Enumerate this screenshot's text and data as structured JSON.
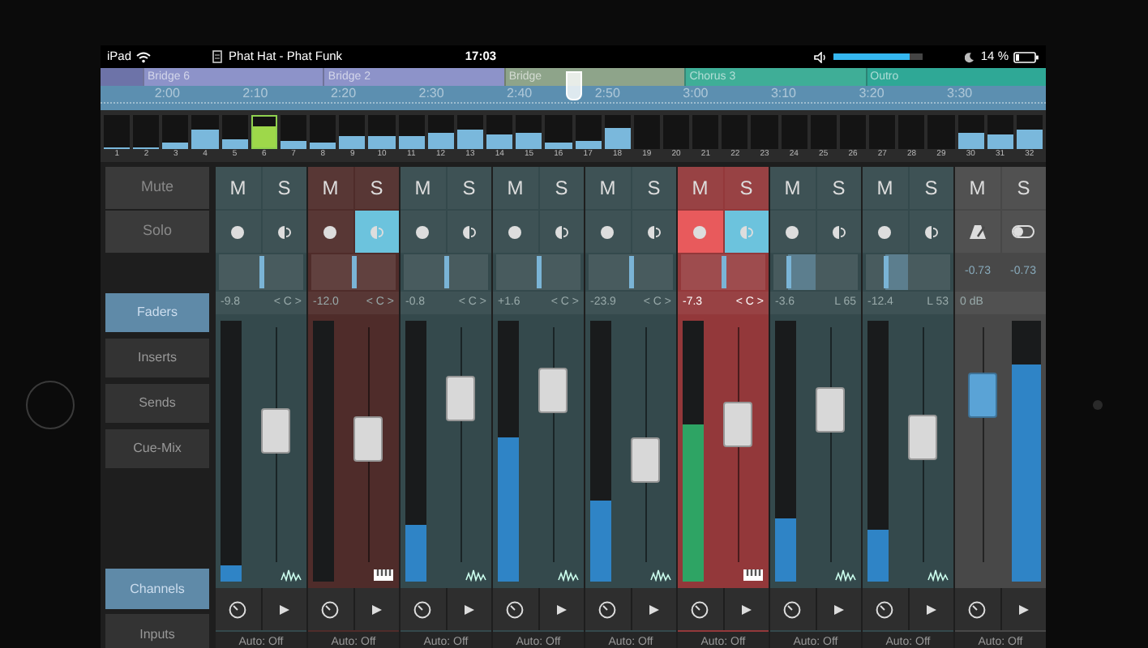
{
  "status_bar": {
    "device": "iPad",
    "song": "Phat Hat - Phat Funk",
    "time": "17:03",
    "volume": {
      "level": 0.85
    },
    "battery": "14 %"
  },
  "timeline": {
    "sections": [
      {
        "label": "Bridge 6",
        "color": "#8d93c9"
      },
      {
        "label": "Bridge 2",
        "color": "#8d93c9"
      },
      {
        "label": "Bridge",
        "color": "#8ea48a"
      },
      {
        "label": "Chorus 3",
        "color": "#3fae97"
      },
      {
        "label": "Outro",
        "color": "#2fa896"
      }
    ],
    "times": [
      "2:00",
      "2:10",
      "2:20",
      "2:30",
      "2:40",
      "2:50",
      "3:00",
      "3:10",
      "3:20",
      "3:30"
    ],
    "playhead": {
      "level": 0.5
    }
  },
  "overview": [
    {
      "number": "1",
      "level": 0.05,
      "selected": false
    },
    {
      "number": "2",
      "level": 0.05,
      "selected": false
    },
    {
      "number": "3",
      "level": 0.2,
      "selected": false
    },
    {
      "number": "4",
      "level": 0.55,
      "selected": false
    },
    {
      "number": "5",
      "level": 0.3,
      "selected": false
    },
    {
      "number": "6",
      "level": 0.7,
      "selected": true
    },
    {
      "number": "7",
      "level": 0.25,
      "selected": false
    },
    {
      "number": "8",
      "level": 0.2,
      "selected": false
    },
    {
      "number": "9",
      "level": 0.4,
      "selected": false
    },
    {
      "number": "10",
      "level": 0.4,
      "selected": false
    },
    {
      "number": "11",
      "level": 0.4,
      "selected": false
    },
    {
      "number": "12",
      "level": 0.5,
      "selected": false
    },
    {
      "number": "13",
      "level": 0.55,
      "selected": false
    },
    {
      "number": "14",
      "level": 0.45,
      "selected": false
    },
    {
      "number": "15",
      "level": 0.5,
      "selected": false
    },
    {
      "number": "16",
      "level": 0.2,
      "selected": false
    },
    {
      "number": "17",
      "level": 0.25,
      "selected": false
    },
    {
      "number": "18",
      "level": 0.6,
      "selected": false
    },
    {
      "number": "19",
      "level": 0,
      "selected": false
    },
    {
      "number": "20",
      "level": 0,
      "selected": false
    },
    {
      "number": "21",
      "level": 0,
      "selected": false
    },
    {
      "number": "22",
      "level": 0,
      "selected": false
    },
    {
      "number": "23",
      "level": 0,
      "selected": false
    },
    {
      "number": "24",
      "level": 0,
      "selected": false
    },
    {
      "number": "25",
      "level": 0,
      "selected": false
    },
    {
      "number": "26",
      "level": 0,
      "selected": false
    },
    {
      "number": "27",
      "level": 0,
      "selected": false
    },
    {
      "number": "28",
      "level": 0,
      "selected": false
    },
    {
      "number": "29",
      "level": 0,
      "selected": false
    },
    {
      "number": "30",
      "level": 0.5,
      "selected": false
    },
    {
      "number": "31",
      "level": 0.45,
      "selected": false
    },
    {
      "number": "32",
      "level": 0.55,
      "selected": false
    }
  ],
  "side_panel": {
    "row_labels": [
      "Mute",
      "Solo"
    ],
    "modes": [
      {
        "label": "Faders",
        "selected": true
      },
      {
        "label": "Inserts",
        "selected": false
      },
      {
        "label": "Sends",
        "selected": false
      },
      {
        "label": "Cue-Mix",
        "selected": false
      }
    ],
    "views": [
      {
        "label": "Channels",
        "selected": true
      },
      {
        "label": "Inputs",
        "selected": false
      }
    ]
  },
  "channels": [
    {
      "kind": "audio",
      "color": "#34494c",
      "mute_label": "M",
      "solo_label": "S",
      "muted": false,
      "soloed": false,
      "record": false,
      "monitor": false,
      "pan": {
        "level": 0.5
      },
      "volume": "-9.8",
      "pan_text": "< C >",
      "fader": {
        "level": 0.57
      },
      "meter": {
        "level": 0.06
      },
      "automation": "Auto: Off"
    },
    {
      "kind": "instrument",
      "color": "#4f2c2a",
      "mute_label": "M",
      "solo_label": "S",
      "muted": false,
      "soloed": false,
      "record": false,
      "monitor": true,
      "pan": {
        "level": 0.5
      },
      "volume": "-12.0",
      "pan_text": "< C >",
      "fader": {
        "level": 0.53
      },
      "meter": {
        "level": 0
      },
      "automation": "Auto: Off"
    },
    {
      "kind": "audio",
      "color": "#34494c",
      "mute_label": "M",
      "solo_label": "S",
      "muted": false,
      "soloed": false,
      "record": false,
      "monitor": false,
      "pan": {
        "level": 0.5
      },
      "volume": "-0.8",
      "pan_text": "< C >",
      "fader": {
        "level": 0.74
      },
      "meter": {
        "level": 0.22
      },
      "automation": "Auto: Off"
    },
    {
      "kind": "audio",
      "color": "#34494c",
      "mute_label": "M",
      "solo_label": "S",
      "muted": false,
      "soloed": false,
      "record": false,
      "monitor": false,
      "pan": {
        "level": 0.5
      },
      "volume": "+1.6",
      "pan_text": "< C >",
      "fader": {
        "level": 0.79
      },
      "meter": {
        "level": 0.55
      },
      "automation": "Auto: Off"
    },
    {
      "kind": "audio",
      "color": "#34494c",
      "mute_label": "M",
      "solo_label": "S",
      "muted": false,
      "soloed": false,
      "record": false,
      "monitor": false,
      "pan": {
        "level": 0.5
      },
      "volume": "-23.9",
      "pan_text": "< C >",
      "fader": {
        "level": 0.42
      },
      "meter": {
        "level": 0.31
      },
      "automation": "Auto: Off"
    },
    {
      "kind": "instrument",
      "color": "#93383a",
      "mute_label": "M",
      "solo_label": "S",
      "muted": false,
      "soloed": false,
      "record": true,
      "monitor": true,
      "pan": {
        "level": 0.5
      },
      "volume": "-7.3",
      "pan_text": "< C >",
      "fader": {
        "level": 0.61
      },
      "meter": {
        "level": 0.6
      },
      "automation": "Auto: Off"
    },
    {
      "kind": "audio",
      "color": "#34494c",
      "mute_label": "M",
      "solo_label": "S",
      "muted": false,
      "soloed": false,
      "record": false,
      "monitor": false,
      "pan": {
        "level": 0.18
      },
      "volume": "-3.6",
      "pan_text": "L 65",
      "fader": {
        "level": 0.68
      },
      "meter": {
        "level": 0.24
      },
      "automation": "Auto: Off"
    },
    {
      "kind": "audio",
      "color": "#34494c",
      "mute_label": "M",
      "solo_label": "S",
      "muted": false,
      "soloed": false,
      "record": false,
      "monitor": false,
      "pan": {
        "level": 0.24
      },
      "volume": "-12.4",
      "pan_text": "L 53",
      "fader": {
        "level": 0.54
      },
      "meter": {
        "level": 0.2
      },
      "automation": "Auto: Off"
    },
    {
      "kind": "master",
      "color": "#484848",
      "mute_label": "M",
      "solo_label": "S",
      "readings": [
        "-0.73",
        "-0.73"
      ],
      "volume": "0 dB",
      "fader": {
        "level": 0.76
      },
      "meter": {
        "level": 0.83
      },
      "automation": "Auto: Off"
    }
  ]
}
